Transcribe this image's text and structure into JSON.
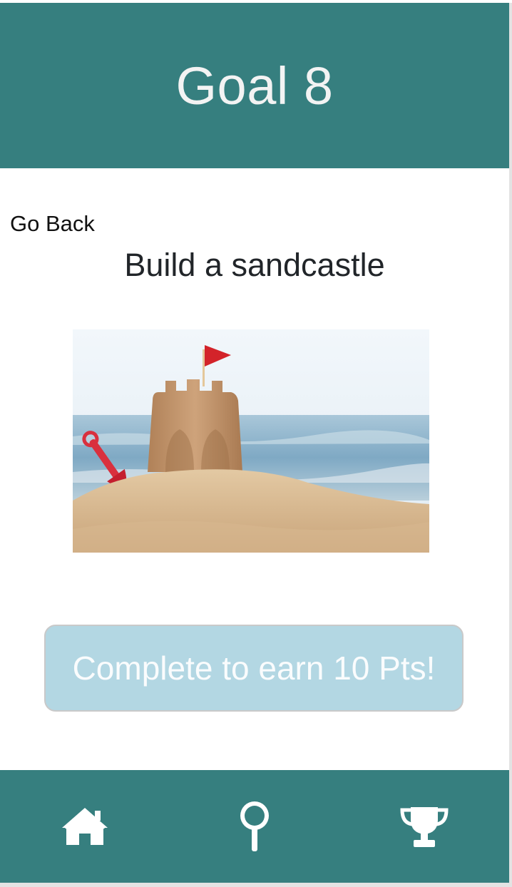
{
  "header": {
    "title": "Goal 8"
  },
  "nav_link": {
    "back_label": "Go Back"
  },
  "goal": {
    "name": "Build a sandcastle",
    "image_subject": "sandcastle with red flag and red toy shovel on a beach"
  },
  "cta": {
    "label": "Complete to earn 10 Pts!"
  },
  "bottom_nav": {
    "items": [
      {
        "icon": "home-icon"
      },
      {
        "icon": "magnifier-icon"
      },
      {
        "icon": "trophy-icon"
      }
    ]
  },
  "colors": {
    "brand": "#367f7f",
    "cta_background": "#b3d7e3",
    "cta_text": "#fafcfd",
    "title_text": "#212529"
  }
}
